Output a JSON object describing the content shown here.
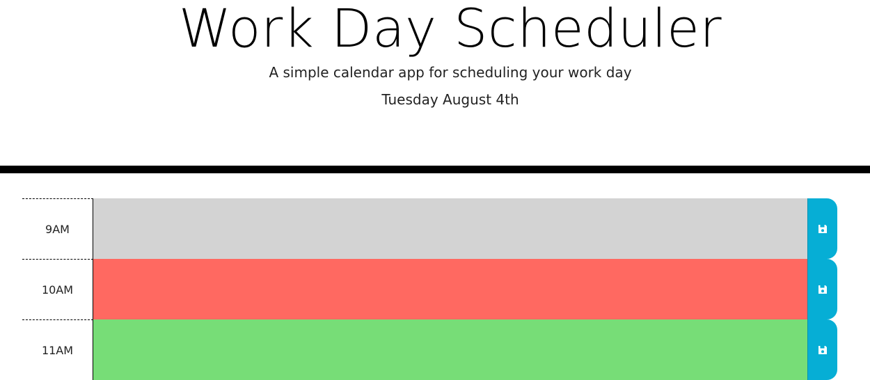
{
  "header": {
    "title": "Work Day Scheduler",
    "subtitle": "A simple calendar app for scheduling your work day",
    "current_day": "Tuesday August 4th"
  },
  "colors": {
    "past": "#d3d3d3",
    "present": "#ff6961",
    "future": "#77dd77",
    "save_button": "#06aed5",
    "divider": "#000000"
  },
  "time_blocks": [
    {
      "hour": "9AM",
      "status": "past",
      "description": "",
      "save_icon": "floppy-disk-icon"
    },
    {
      "hour": "10AM",
      "status": "present",
      "description": "",
      "save_icon": "floppy-disk-icon"
    },
    {
      "hour": "11AM",
      "status": "future",
      "description": "",
      "save_icon": "floppy-disk-icon"
    }
  ]
}
